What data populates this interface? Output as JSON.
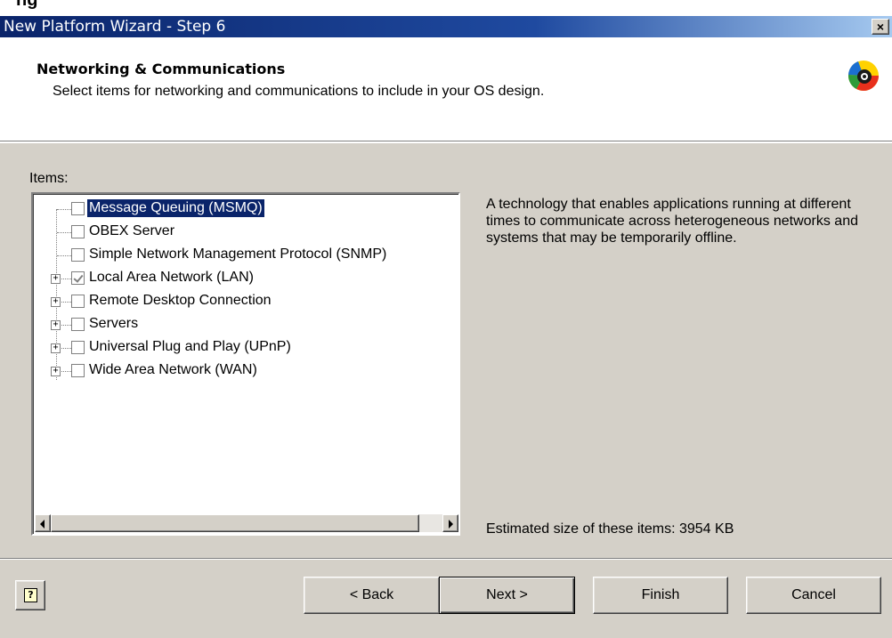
{
  "window": {
    "title": "New Platform Wizard - Step 6",
    "close_label": "×"
  },
  "header": {
    "title": "Networking & Communications",
    "subtitle": "Select items for networking and communications to include in your OS design.",
    "logo_icon": "platform-builder-logo-icon"
  },
  "items_label": "Items:",
  "tree": {
    "items": [
      {
        "label": "Message Queuing (MSMQ)",
        "checked": false,
        "expandable": false,
        "selected": true
      },
      {
        "label": "OBEX Server",
        "checked": false,
        "expandable": false,
        "selected": false
      },
      {
        "label": "Simple Network Management Protocol (SNMP)",
        "checked": false,
        "expandable": false,
        "selected": false
      },
      {
        "label": "Local Area Network (LAN)",
        "checked": true,
        "expandable": true,
        "selected": false
      },
      {
        "label": "Remote Desktop Connection",
        "checked": false,
        "expandable": true,
        "selected": false
      },
      {
        "label": "Servers",
        "checked": false,
        "expandable": true,
        "selected": false
      },
      {
        "label": "Universal Plug and Play (UPnP)",
        "checked": false,
        "expandable": true,
        "selected": false
      },
      {
        "label": "Wide Area Network (WAN)",
        "checked": false,
        "expandable": true,
        "selected": false
      }
    ]
  },
  "description": "A technology that enables applications running at different times to communicate across heterogeneous networks and systems that may be temporarily offline.",
  "estimated_size": "Estimated size of these items: 3954 KB",
  "buttons": {
    "help": "?",
    "back": "< Back",
    "next": "Next >",
    "finish": "Finish",
    "cancel": "Cancel"
  },
  "colors": {
    "title_bar": "#0a246a",
    "selection": "#0a246a",
    "dialog_face": "#d4d0c8"
  }
}
